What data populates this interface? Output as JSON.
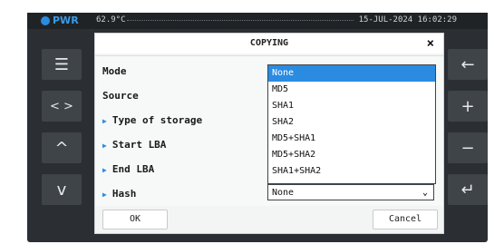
{
  "statusbar": {
    "power_label": "PWR",
    "temperature": "62.9°C",
    "datetime": "15-JUL-2024 16:02:29"
  },
  "sidebar_left": [
    {
      "icon": "menu-icon",
      "glyph": "☰"
    },
    {
      "icon": "code-brackets-icon",
      "glyph": "< >"
    },
    {
      "icon": "up-icon",
      "glyph": "^"
    },
    {
      "icon": "down-icon",
      "glyph": "v"
    }
  ],
  "sidebar_right": [
    {
      "icon": "back-arrow-icon",
      "glyph": "←"
    },
    {
      "icon": "plus-icon",
      "glyph": "+"
    },
    {
      "icon": "minus-icon",
      "glyph": "−"
    },
    {
      "icon": "enter-icon",
      "glyph": "↵"
    }
  ],
  "dialog": {
    "title": "COPYING",
    "close_glyph": "×",
    "rows": [
      {
        "label": "Mode",
        "marker": ""
      },
      {
        "label": "Source",
        "marker": ""
      },
      {
        "label": "Type of storage",
        "marker": "▶"
      },
      {
        "label": "Start LBA",
        "marker": "▶"
      },
      {
        "label": "End LBA",
        "marker": "▶"
      },
      {
        "label": "Hash",
        "marker": "▶"
      }
    ],
    "hash_options": [
      "None",
      "MD5",
      "SHA1",
      "SHA2",
      "MD5+SHA1",
      "MD5+SHA2",
      "SHA1+SHA2"
    ],
    "hash_selected": "None",
    "ok_label": "OK",
    "cancel_label": "Cancel"
  },
  "colors": {
    "accent": "#2a8be0",
    "device_bg": "#2b2f33",
    "button_bg": "#3f4448"
  }
}
